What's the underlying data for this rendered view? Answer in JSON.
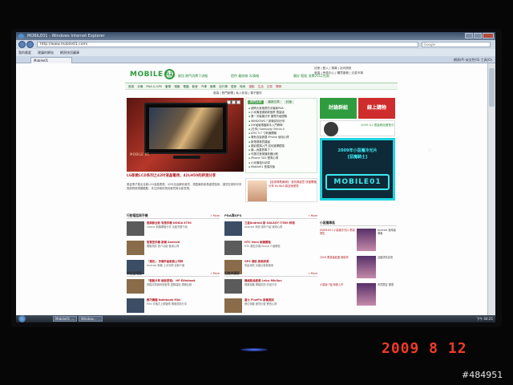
{
  "browser": {
    "window_title": "MOBILE01 - Windows Internet Explorer",
    "url": "http://www.mobile01.com/",
    "search_placeholder": "Google",
    "tab_label": "Mobile01",
    "links_bar": [
      "我的最愛",
      "建議的網站",
      "網頁快訊圖庫"
    ],
    "tools": "網頁(P)  安全性(S)  工具(O)"
  },
  "site": {
    "logo_text": "MOBILE",
    "logo_num": "01",
    "taglines": [
      "提供 · 資訊 熱門消費下流報",
      "提供 最前線 3c情報",
      "最好 輕鬆 消費2012先詢"
    ],
    "user_links": "註冊 | 登入 | 搜尋 | 站內簡訊",
    "user_links2": "首頁 | 會員中心 | 購買服務 | 交易市場",
    "menu": [
      "首頁",
      "手機",
      "PDA & GPS",
      "筆電",
      "相機",
      "電腦",
      "影音",
      "汽車",
      "機車",
      "自行車",
      "居家",
      "時尚",
      "運動",
      "生活",
      "交易",
      "閒聊"
    ],
    "breadcrumb": "首頁 | 熱門新聞 | 私人訊息 | 電子郵件",
    "hero_label": "MOBILE 01",
    "headline": "LG新款LCD系列之42吋液晶電視，42LH50的評測分享",
    "lead": "樂金電子推出全新LCD液晶電視，42吋全高解析畫質，搭載最新影像處理技術，讓您在家即可享受劇院般視聽體驗，本文詳細評測其畫質與功能表現。",
    "news_tabs": [
      "熱門文章",
      "最新文章",
      "討論"
    ],
    "news": [
      "請問大家推薦的手機與PDA",
      "小米機漫畫新款推薦 限量版",
      "第一次裝機分享 筆電升級經驗",
      "WINDOWS 7 新機試用分享",
      "DIY組裝電腦新手入門教學",
      "[分享] Samsung Omnia II",
      "ATIV 5.7 寸新機開箱",
      "擁有自製遮罩 iPhone 使用心得",
      "新電視購買建議",
      "攝影鏡頭入門 如何選擇鏡頭",
      "機—我要賣車了 !",
      "可攜式音樂播放器比較",
      "iPhone 3GS 實測心得",
      "小米機相片紀錄",
      "Mobile01 首頁改版"
    ],
    "promo_text": "【影音專題報導】 音效與創意 快速開箱分享 NVIDIA 新技術發表",
    "btn_left": "討論群組",
    "btn_right": "線上購物",
    "side_ad_text": "2009 Q1 限量精品發售中",
    "cyan_line1": "2009年小惡魔冷光片",
    "cyan_line2": "[惡魔騎士]",
    "cyan_logo": "MOBILE01",
    "more_label": "» More",
    "sections": [
      {
        "title": "行動電話與手機",
        "items": [
          {
            "t": "經典款全新 有感手機 NOKIA 6730",
            "d": "classic 新機開箱分享 功能完整介紹"
          },
          {
            "t": "智慧型手機 新機 Android",
            "d": "開箱測試 簡介功能 使用心得"
          },
          {
            "t": "「遇見」 手機升級新款上市評",
            "d": "Android 新機 上手評測 全新介面"
          }
        ]
      },
      {
        "title": "筆記型電腦",
        "items": [
          {
            "t": "「輕鬆分享 極致登場」 HP Elitebook",
            "d": "效能評測與商用筆電 選購建議 規格比較"
          },
          {
            "t": "輕巧機種 Notebook Mini",
            "d": "Mini 可攜式上網筆電 開箱測試分享"
          }
        ]
      },
      {
        "title": "PDA與GPS",
        "items": [
          {
            "t": "三星Android 新 GALAXY i7500 評測",
            "d": "Android 系統 操作介紹 使用心得"
          },
          {
            "t": "HTC Hero 新機開箱",
            "d": "HTC 觸控手機 Sense 介面體驗"
          },
          {
            "t": "GPS 導航 新款評測",
            "d": "衛星導航 功能比較與使用"
          }
        ]
      },
      {
        "title": "相機與攝影",
        "items": [
          {
            "t": "機械新品報導 Leica Minilux",
            "d": "經典相機 開箱試拍 作品分享"
          },
          {
            "t": "富士 FinePix 新機測試",
            "d": "數位相機 畫質比較 實拍心得"
          }
        ]
      }
    ],
    "right_col_title": "小惡魔專區",
    "right_boxes": [
      {
        "tx": "MOBILE01 小惡魔冷光片 限量發售",
        "tx2": "Android 使用者專屬"
      },
      {
        "tx": "2009 限量鑰匙圈 與徽章",
        "tx2": "活動詳情請見"
      },
      {
        "tx": "小惡魔 T恤 新款上市",
        "tx2": "會員限定 優惠"
      }
    ]
  },
  "taskbar": {
    "items": [
      "Mobile01 ...",
      "Window..."
    ],
    "clock": "下午 04:21"
  },
  "photo": {
    "datestamp": "2009  8 12",
    "watermark": "#484951"
  }
}
